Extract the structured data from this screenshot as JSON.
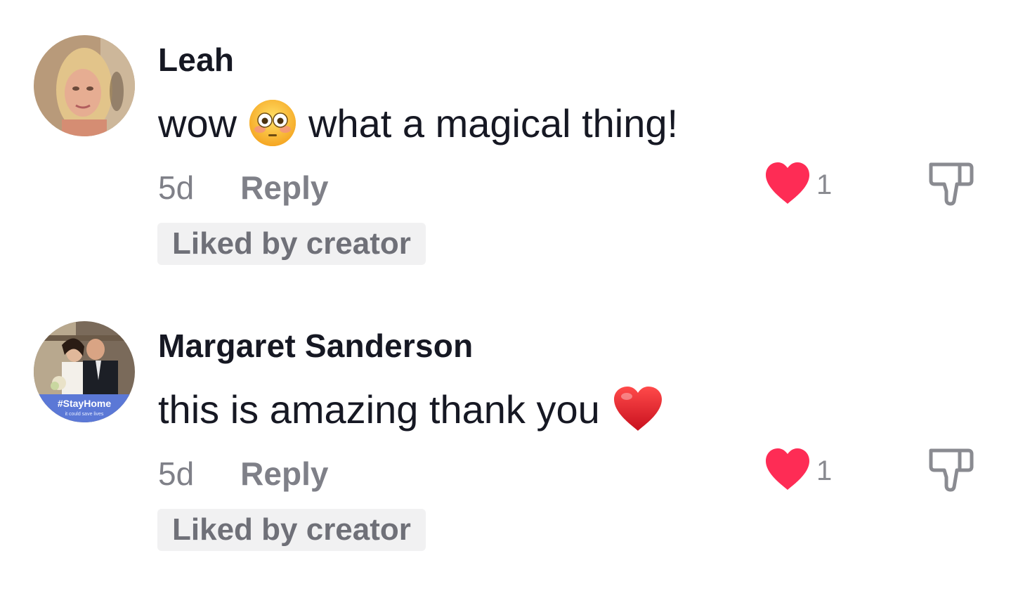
{
  "comments": [
    {
      "username": "Leah",
      "text_before": "wow",
      "emoji": "flushed-face",
      "text_after": "what a magical thing!",
      "time": "5d",
      "reply_label": "Reply",
      "like_count": "1",
      "liked_by_creator_label": "Liked by creator"
    },
    {
      "username": "Margaret Sanderson",
      "text_before": "this is amazing thank you",
      "emoji": "red-heart",
      "text_after": "",
      "time": "5d",
      "reply_label": "Reply",
      "like_count": "1",
      "liked_by_creator_label": "Liked by creator",
      "avatar_overlay": {
        "tag": "#StayHome",
        "subtext": "it could save lives"
      }
    }
  ],
  "colors": {
    "like_heart": "#fe2c55",
    "muted_text": "#7f8088",
    "badge_bg": "#f1f1f2",
    "primary_text": "#161823"
  }
}
